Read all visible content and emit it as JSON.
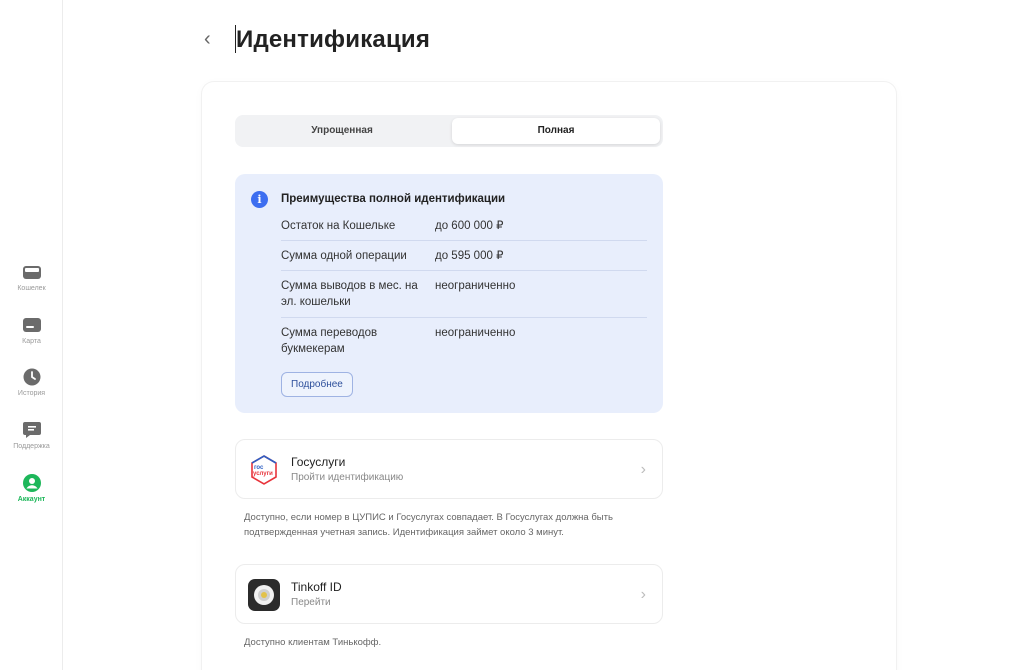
{
  "sidebar": {
    "items": [
      {
        "label": "Кошелек",
        "icon": "wallet-icon"
      },
      {
        "label": "Карта",
        "icon": "card-icon"
      },
      {
        "label": "История",
        "icon": "clock-icon"
      },
      {
        "label": "Поддержка",
        "icon": "chat-icon"
      },
      {
        "label": "Аккаунт",
        "icon": "user-icon",
        "active": true
      }
    ]
  },
  "header": {
    "back": "‹",
    "title": "Идентификация"
  },
  "tabs": [
    {
      "label": "Упрощенная",
      "selected": false
    },
    {
      "label": "Полная",
      "selected": true
    }
  ],
  "info": {
    "icon": "i",
    "title": "Преимущества полной идентификации",
    "rows": [
      {
        "key": "Остаток на Кошельке",
        "value": "до 600 000 ₽"
      },
      {
        "key": "Сумма одной операции",
        "value": "до 595 000 ₽"
      },
      {
        "key": "Сумма выводов в мес. на эл. кошельки",
        "value": "неограниченно"
      },
      {
        "key": "Сумма переводов букмекерам",
        "value": "неограниченно"
      }
    ],
    "more_label": "Подробнее"
  },
  "options": [
    {
      "title": "Госуслуги",
      "subtitle": "Пройти идентификацию",
      "logo_text_top": "гос",
      "logo_text_bottom": "услуги",
      "chevron": "›",
      "note": "Доступно, если номер в ЦУПИС и Госуслугах совпадает. В Госуслугах должна быть подтвержденная учетная запись. Идентификация займет около 3 минут."
    },
    {
      "title": "Tinkoff ID",
      "subtitle": "Перейти",
      "chevron": "›",
      "note": "Доступно клиентам Тинькофф."
    }
  ],
  "colors": {
    "accent_green": "#1db75a",
    "info_bg": "#e8eefc",
    "info_blue": "#3d6ef0"
  }
}
